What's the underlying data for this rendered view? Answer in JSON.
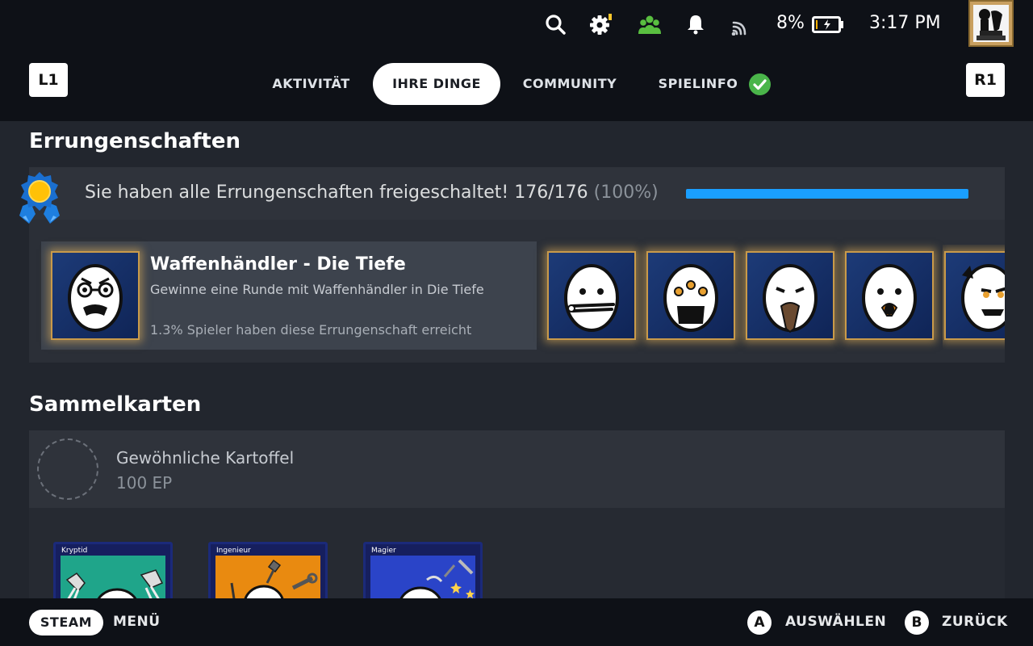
{
  "status": {
    "icons": [
      "search-icon",
      "settings-icon",
      "friends-icon",
      "bell-icon",
      "wifi-icon",
      "battery-icon"
    ],
    "battery_percent": "8%",
    "battery_level": 0.08,
    "time": "3:17 PM",
    "colors": {
      "friends": "#59bf40",
      "settings_badge": "#ffc82c"
    }
  },
  "nav": {
    "left_shoulder": "L1",
    "right_shoulder": "R1",
    "tabs": [
      {
        "label": "AKTIVITÄT",
        "active": false
      },
      {
        "label": "IHRE DINGE",
        "active": true
      },
      {
        "label": "COMMUNITY",
        "active": false
      },
      {
        "label": "SPIELINFO",
        "active": false,
        "icon": "check-circle-icon"
      }
    ]
  },
  "achievements": {
    "title": "Errungenschaften",
    "summary_text": "Sie haben alle Errungenschaften freigeschaltet! 176/176",
    "summary_pct": "(100%)",
    "progress": 1.0,
    "accent": "#1a9fff",
    "featured": {
      "name": "Waffenhändler - Die Tiefe",
      "description": "Gewinne eine Runde mit Waffenhändler in Die Tiefe",
      "rarity": "1.3% Spieler haben diese Errungenschaft erreicht"
    },
    "tiles": [
      "achievement-icon",
      "achievement-icon",
      "achievement-icon",
      "achievement-icon",
      "achievement-icon"
    ]
  },
  "trading_cards": {
    "title": "Sammelkarten",
    "badge_name": "Gewöhnliche Kartoffel",
    "badge_xp": "100 EP",
    "cards": [
      {
        "label": "Kryptid",
        "color": "#1fa58a"
      },
      {
        "label": "Ingenieur",
        "color": "#e98a10"
      },
      {
        "label": "Magier",
        "color": "#2a44c8"
      }
    ]
  },
  "footer": {
    "steam_label": "STEAM",
    "menu_label": "MENÜ",
    "a_button": "A",
    "a_label": "AUSWÄHLEN",
    "b_button": "B",
    "b_label": "ZURÜCK"
  }
}
